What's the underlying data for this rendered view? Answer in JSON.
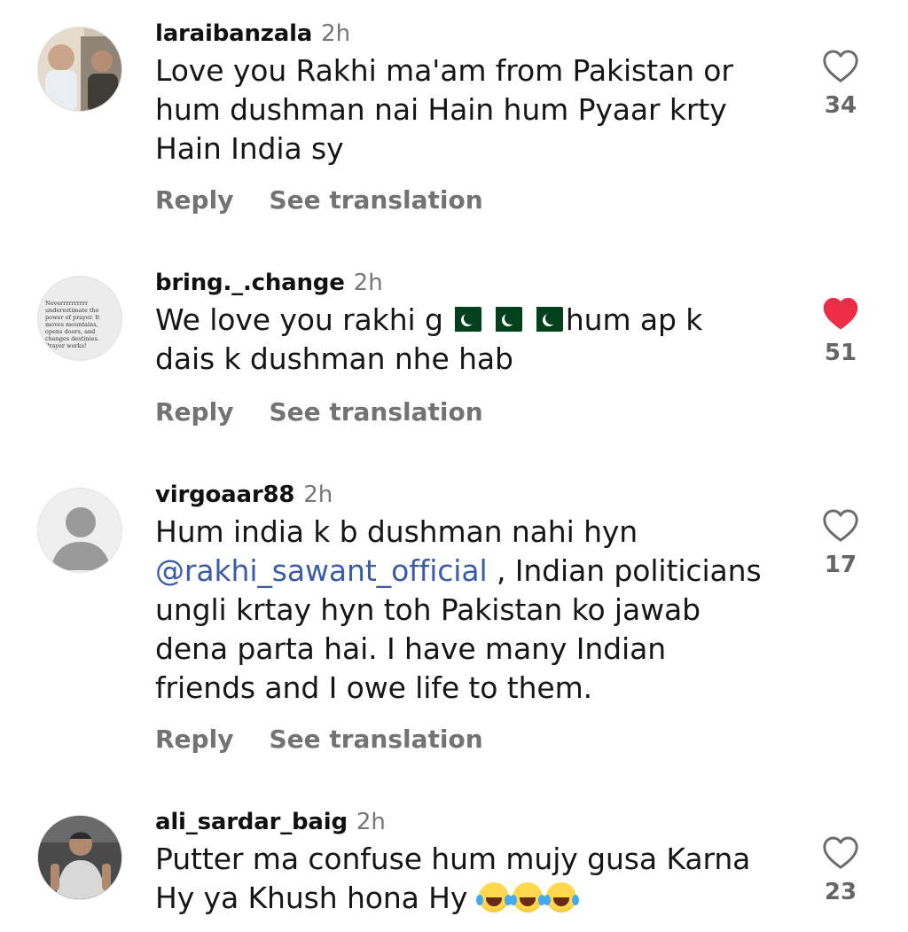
{
  "comments": [
    {
      "username": "laraibanzala",
      "time": "2h",
      "lines": [
        "Love you Rakhi ma'am from Pakistan or",
        "hum dushman nai Hain hum Pyaar krty",
        "Hain India sy"
      ],
      "reply_label": "Reply",
      "translate_label": "See translation",
      "likes": "34",
      "liked": false
    },
    {
      "username": "bring._.change",
      "time": "2h",
      "text_before_flags": "We love you rakhi g",
      "flags": [
        "pakistan-flag",
        "pakistan-flag",
        "pakistan-flag"
      ],
      "text_after_flags": "hum ap k",
      "line2": "dais k dushman nhe hab",
      "avatar_text": "Neverrrrrrrrrr underestimate the power of prayer. It moves mountains, opens doors, and changes destinies. Prayer works!",
      "reply_label": "Reply",
      "translate_label": "See translation",
      "likes": "51",
      "liked": true
    },
    {
      "username": "virgoaar88",
      "time": "2h",
      "line1": "Hum india k b dushman nahi hyn",
      "mention": "@rakhi_sawant_official",
      "line2_rest": " , Indian politicians",
      "line3": "ungli krtay hyn toh Pakistan ko jawab",
      "line4": "dena parta hai. I have many Indian",
      "line5": "friends and I owe life to them.",
      "reply_label": "Reply",
      "translate_label": "See translation",
      "likes": "17",
      "liked": false
    },
    {
      "username": "ali_sardar_baig",
      "time": "2h",
      "line1": "Putter ma confuse hum mujy gusa Karna",
      "line2": "Hy ya Khush hona Hy",
      "emojis": [
        "face-with-tears-of-joy",
        "face-with-tears-of-joy",
        "face-with-tears-of-joy"
      ],
      "likes": "23",
      "liked": false
    }
  ],
  "colors": {
    "liked_heart": "#ed2d47",
    "mention": "#3a5ca8",
    "secondary_text": "#737373"
  }
}
